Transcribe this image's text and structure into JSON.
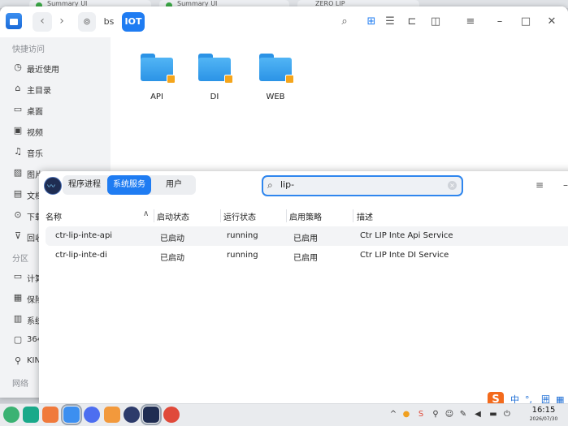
{
  "browser_tabs": [
    "Summary UI",
    "Summary UI",
    "ZERO LIP"
  ],
  "file_manager": {
    "breadcrumb": [
      "bs",
      "IOT"
    ],
    "sidebar": {
      "quick_access_label": "快捷访问",
      "items": [
        {
          "icon": "clock-icon",
          "label": "最近使用"
        },
        {
          "icon": "home-icon",
          "label": "主目录"
        },
        {
          "icon": "desktop-icon",
          "label": "桌面"
        },
        {
          "icon": "video-icon",
          "label": "视频"
        },
        {
          "icon": "music-icon",
          "label": "音乐"
        },
        {
          "icon": "picture-icon",
          "label": "图片"
        },
        {
          "icon": "document-icon",
          "label": "文档"
        },
        {
          "icon": "download-icon",
          "label": "下载"
        },
        {
          "icon": "trash-icon",
          "label": "回收"
        }
      ],
      "partitions_label": "分区",
      "partitions": [
        {
          "icon": "computer-icon",
          "label": "计算"
        },
        {
          "icon": "shield-icon",
          "label": "保险"
        },
        {
          "icon": "disk-icon",
          "label": "系统"
        },
        {
          "icon": "drive-icon",
          "label": "364"
        },
        {
          "icon": "usb-icon",
          "label": "KIN"
        }
      ],
      "network_label": "网络"
    },
    "folders": [
      {
        "name": "API",
        "locked": true
      },
      {
        "name": "DI",
        "locked": true
      },
      {
        "name": "WEB",
        "locked": true
      }
    ]
  },
  "system_monitor": {
    "tabs": [
      {
        "label": "程序进程",
        "active": false
      },
      {
        "label": "系统服务",
        "active": true
      },
      {
        "label": "用户",
        "active": false
      }
    ],
    "search": {
      "value": "lip-"
    },
    "columns": [
      "名称",
      "启动状态",
      "运行状态",
      "启用策略",
      "描述"
    ],
    "rows": [
      {
        "name": "ctr-lip-inte-api",
        "startup": "已启动",
        "status": "running",
        "policy": "已启用",
        "desc": "Ctr LIP Inte Api Service"
      },
      {
        "name": "ctr-lip-inte-di",
        "startup": "已启动",
        "status": "running",
        "policy": "已启用",
        "desc": "Ctr LIP Inte DI Service"
      }
    ]
  },
  "ime": {
    "logo": "S",
    "lang": "中",
    "punct": "°,",
    "mode": "囲"
  },
  "clock": {
    "time": "16:15",
    "date": "2026/07/30"
  },
  "colors": {
    "accent": "#1f7cf2",
    "folder": "#2b93e6",
    "ime": "#f36a1c"
  }
}
